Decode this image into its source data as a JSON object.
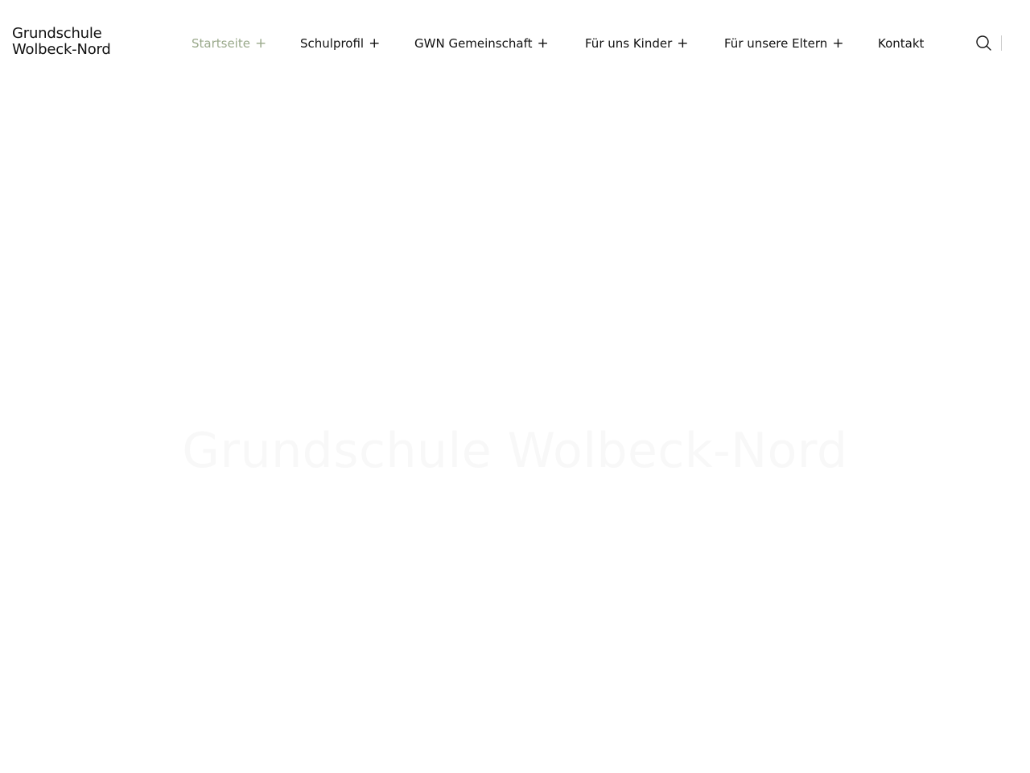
{
  "site": {
    "logo_line1": "Grundschule",
    "logo_line2": "Wolbeck-Nord"
  },
  "nav": {
    "items": [
      {
        "label": "Startseite",
        "has_submenu": true,
        "active": true
      },
      {
        "label": "Schulprofil",
        "has_submenu": true,
        "active": false
      },
      {
        "label": "GWN Gemeinschaft",
        "has_submenu": true,
        "active": false
      },
      {
        "label": "Für uns Kinder",
        "has_submenu": true,
        "active": false
      },
      {
        "label": "Für unsere Eltern",
        "has_submenu": true,
        "active": false
      },
      {
        "label": "Kontakt",
        "has_submenu": false,
        "active": false
      }
    ],
    "submenu_marker": "+",
    "search_icon": "search-icon"
  },
  "hero": {
    "title": "Grundschule Wolbeck-Nord"
  },
  "colors": {
    "accent": "#9aa98b",
    "text": "#111111",
    "background": "#ffffff",
    "hero_title": "#f8f8f8"
  }
}
